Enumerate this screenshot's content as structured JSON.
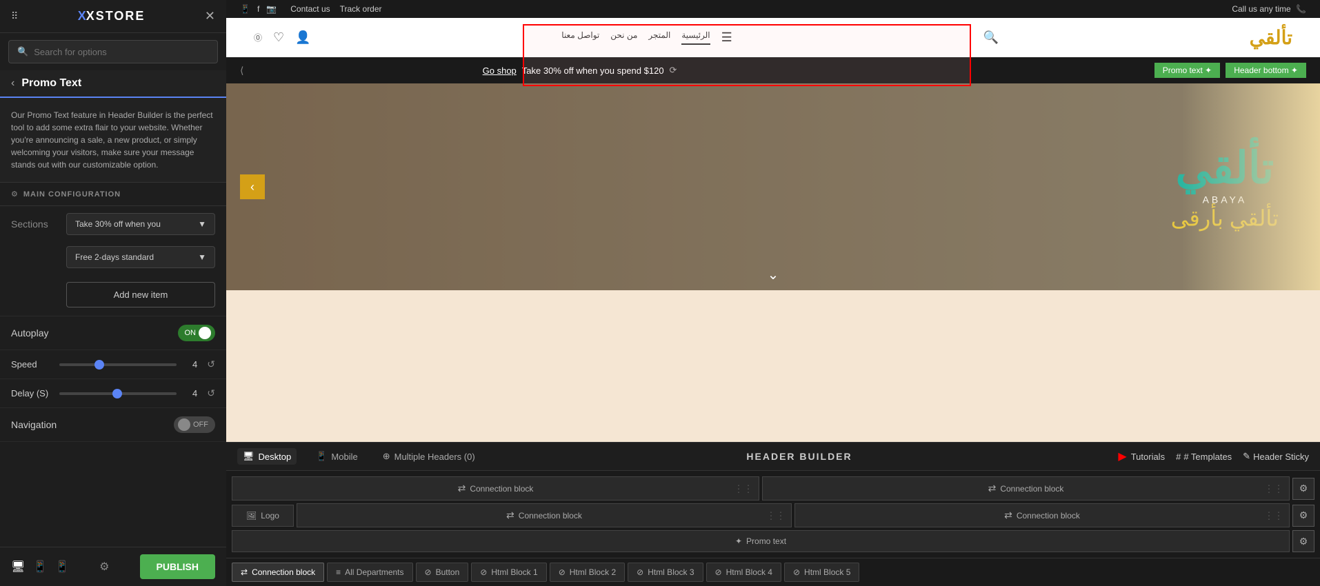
{
  "app": {
    "logo": "XSTORE",
    "logo_prefix": "X"
  },
  "search": {
    "placeholder": "Search for options"
  },
  "promo_text": {
    "title": "Promo Text",
    "description": "Our Promo Text feature in Header Builder is the perfect tool to add some extra flair to your website. Whether you're announcing a sale, a new product, or simply welcoming your visitors, make sure your message stands out with our customizable option."
  },
  "main_config": {
    "title": "MAIN CONFIGURATION"
  },
  "sections": {
    "label": "Sections",
    "item1": "Take 30% off when you",
    "item2": "Free 2-days standard",
    "add_new": "Add new item"
  },
  "autoplay": {
    "label": "Autoplay",
    "value": "ON",
    "state": true
  },
  "speed": {
    "label": "Speed",
    "value": "4"
  },
  "delay": {
    "label": "Delay (S)",
    "value": "4"
  },
  "navigation": {
    "label": "Navigation",
    "value": "OFF",
    "state": false
  },
  "footer": {
    "publish_label": "PUBLISH"
  },
  "top_bar": {
    "contact": "Contact us",
    "track_order": "Track order",
    "call": "Call us any time"
  },
  "nav": {
    "home": "الرئيسية",
    "store": "المتجر",
    "about": "من نحن",
    "contact": "تواصل معنا"
  },
  "promo_bar": {
    "link_text": "Go shop",
    "text": "Take 30% off when you spend $120",
    "promo_label": "Promo text ✦",
    "header_bottom_label": "Header bottom ✦"
  },
  "builder": {
    "title": "HEADER BUILDER",
    "tutorials": "Tutorials",
    "templates": "# Templates",
    "header_sticky": "Header Sticky",
    "devices": {
      "desktop": "Desktop",
      "mobile": "Mobile",
      "multiple": "Multiple Headers (0)"
    }
  },
  "builder_rows": {
    "row1_left": "Connection block",
    "row1_right": "Connection block",
    "row2_logo": "Logo",
    "row2_center": "Connection block",
    "row2_right": "Connection block",
    "row3_promo": "Promo text"
  },
  "blocks_bar": {
    "items": [
      {
        "label": "Connection block",
        "icon": "⇄",
        "active": true
      },
      {
        "label": "All Departments",
        "icon": "≡",
        "active": false
      },
      {
        "label": "Button",
        "icon": "⊘",
        "active": false
      },
      {
        "label": "Html Block 1",
        "icon": "⊘",
        "active": false
      },
      {
        "label": "Html Block 2",
        "icon": "⊘",
        "active": false
      },
      {
        "label": "Html Block 3",
        "icon": "⊘",
        "active": false
      },
      {
        "label": "Html Block 4",
        "icon": "⊘",
        "active": false
      },
      {
        "label": "Html Block 5",
        "icon": "⊘",
        "active": false
      }
    ]
  }
}
